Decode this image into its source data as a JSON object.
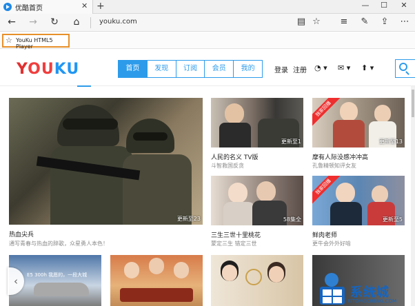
{
  "browser": {
    "tab_title": "优酷首页",
    "tab_close": "✕",
    "new_tab": "+",
    "window_controls": [
      "—",
      "☐",
      "✕"
    ],
    "nav_icons": [
      "back-icon",
      "forward-icon",
      "refresh-icon",
      "home-icon"
    ],
    "nav_glyphs": [
      "←",
      "→",
      "↻",
      "⌂"
    ],
    "address_url": "youku.com",
    "toolbar_icons": [
      "reading-view-icon",
      "favorite-star-icon",
      "hub-icon",
      "web-note-icon",
      "share-icon",
      "more-icon"
    ],
    "toolbar_glyphs": [
      "▤",
      "☆",
      "≡",
      "✎",
      "⇪",
      "⋯"
    ]
  },
  "favorites_bar": {
    "star_glyph": "☆",
    "item_label": "YouKu HTML5 Player",
    "highlight_color": "#e8902a"
  },
  "site": {
    "logo": {
      "y": "Y",
      "ou": "OU",
      "ku": "KU"
    },
    "nav_tabs": [
      "首页",
      "发现",
      "订阅",
      "会员",
      "我的"
    ],
    "active_tab_index": 0,
    "login": "登录",
    "register": "注册",
    "icons": [
      "history-icon",
      "message-icon",
      "upload-icon",
      "search-icon"
    ],
    "icon_glyphs": [
      "◔ ▾",
      "✉ ▾",
      "⬆ ▾"
    ],
    "accent_color": "#2d9bea"
  },
  "cards": {
    "featured": {
      "title": "热血尖兵",
      "subtitle": "通写青春与热血的辞歌，众星勇人本色！",
      "badge": "更新至23"
    },
    "row1": [
      {
        "title": "人民的名义 TV版",
        "subtitle": "斗智救国反贪",
        "badge": "更新至1"
      },
      {
        "title": "摩有人际没感冲冲高",
        "subtitle": "孔鲁精顿知评女友",
        "badge": "更新至13",
        "ribbon": "独家回播"
      }
    ],
    "row2": [
      {
        "title": "三生三世十里桃花",
        "subtitle": "蒙定三生 错定三世",
        "badge": "58集全"
      },
      {
        "title": "鲜肉老师",
        "subtitle": "更牛会外外好啥",
        "badge": "更新至5",
        "ribbon": "独家回播"
      }
    ],
    "row3_badges": [
      "E5 300h 我愿的，一段大城",
      "",
      "",
      ""
    ]
  },
  "overlays": {
    "scroll_left_glyph": "‹",
    "watermark_text": "系统城",
    "watermark_url": "XITONGCHENG.COM"
  }
}
